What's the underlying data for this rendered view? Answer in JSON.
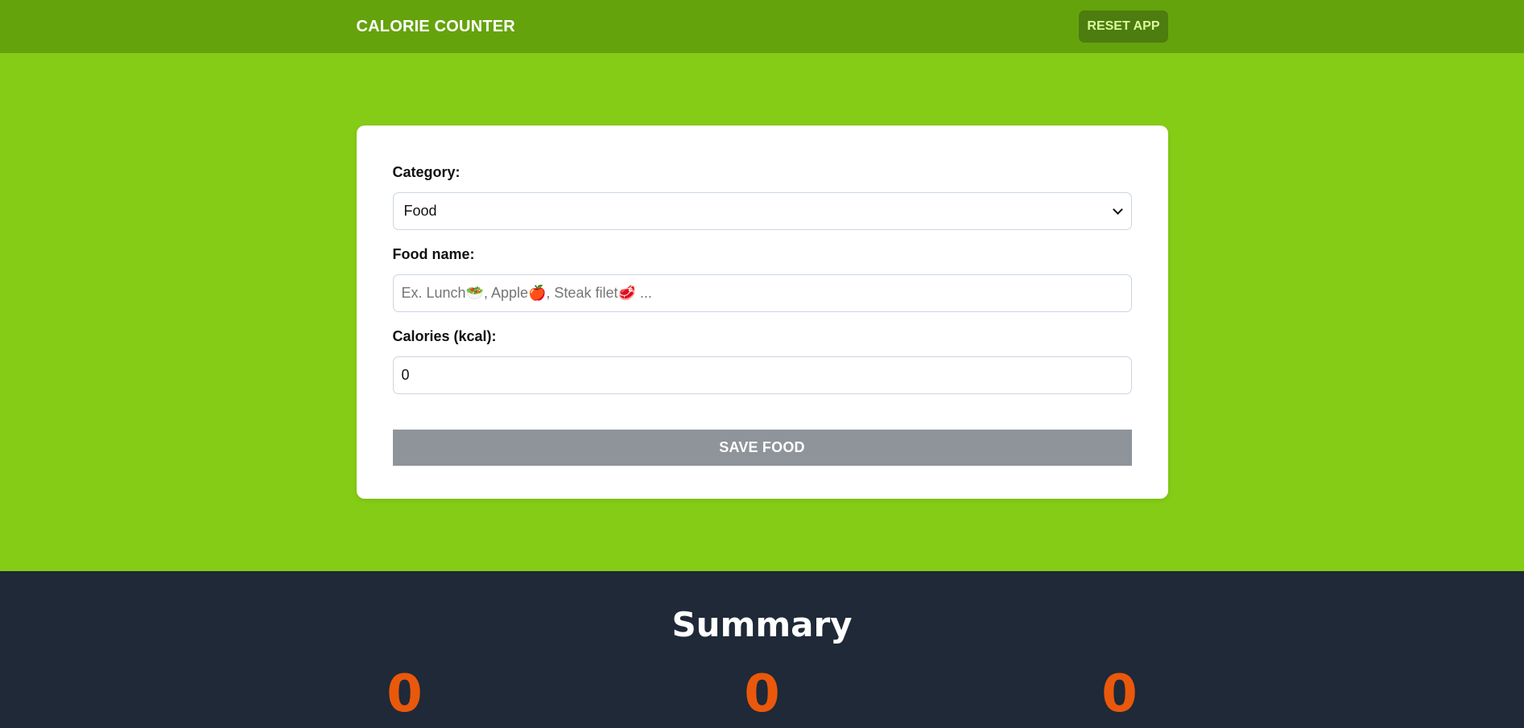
{
  "header": {
    "title": "CALORIE COUNTER",
    "reset_label": "RESET APP"
  },
  "form": {
    "category_label": "Category:",
    "category_value": "Food",
    "food_name_label": "Food name:",
    "food_name_placeholder": "Ex. Lunch🥗, Apple🍎, Steak filet🥩 ...",
    "calories_label": "Calories (kcal):",
    "calories_value": "0",
    "save_label": "SAVE FOOD"
  },
  "summary": {
    "title": "Summary",
    "stats": [
      "0",
      "0",
      "0"
    ]
  },
  "colors": {
    "header_bg": "#65a30d",
    "hero_bg": "#84cc16",
    "summary_bg": "#1f2937",
    "stat_color": "#ea580c",
    "save_disabled": "#8f949b"
  },
  "icons": {
    "select_chevron": "chevron-down-icon"
  }
}
